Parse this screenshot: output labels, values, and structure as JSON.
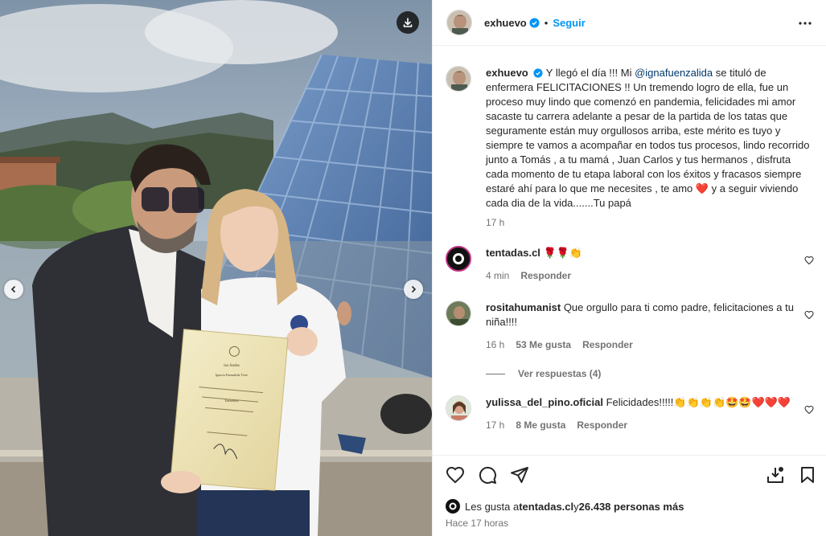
{
  "post": {
    "username": "exhuevo",
    "follow_label": "Seguir",
    "dot": "•",
    "caption_parts": {
      "before_mention": "Y llegó el día !!! Mi ",
      "mention": "@ignafuenzalida",
      "after_mention": " se tituló de enfermera FELICITACIONES !! Un tremendo logro de ella, fue un proceso muy lindo que comenzó en pandemia, felicidades mi amor sacaste tu carrera adelante a pesar de la partida de los tatas que seguramente están muy orgullosos arriba, este mérito es tuyo y siempre te vamos a acompañar en todos tus procesos, lindo recorrido junto a Tomás , a tu mamá , Juan Carlos y tus hermanos , disfruta cada momento de tu etapa laboral con los éxitos y fracasos siempre estaré ahí para lo que me necesites , te amo ",
      "emoji_heart": "❤️",
      "end": " y a seguir viviendo cada dia de la vida.......Tu papá"
    },
    "caption_time": "17 h"
  },
  "comments": [
    {
      "username": "tentadas.cl",
      "text": "🌹🌹👏",
      "time": "4 min",
      "likes": "",
      "reply": "Responder"
    },
    {
      "username": "rositahumanist",
      "text": "Que orgullo para ti como padre, felicitaciones a tu niña!!!!",
      "time": "16 h",
      "likes": "53 Me gusta",
      "reply": "Responder",
      "view_replies": "Ver respuestas (4)"
    },
    {
      "username": "yulissa_del_pino.oficial",
      "text": "Felicidades!!!!!👏👏👏👏🤩🤩❤️❤️❤️",
      "time": "17 h",
      "likes": "8 Me gusta",
      "reply": "Responder"
    }
  ],
  "footer": {
    "likes_prefix": "Les gusta a ",
    "likes_user": "tentadas.cl",
    "likes_mid": " y ",
    "likes_count": "26.438 personas más",
    "time": "Hace 17 horas"
  },
  "diploma": {
    "university": "los Andes",
    "name": "Ignacia Fuenzalida Tórre",
    "title": "Enfermera"
  },
  "icons": [
    "download-icon",
    "chevron-left-icon",
    "chevron-right-icon",
    "verified-icon",
    "more-icon",
    "heart-icon",
    "comment-icon",
    "share-icon",
    "save-icon",
    "bookmark-icon"
  ],
  "colors": {
    "accent": "#0095f6",
    "verified": "#0095f6",
    "heart": "#ed4956"
  }
}
